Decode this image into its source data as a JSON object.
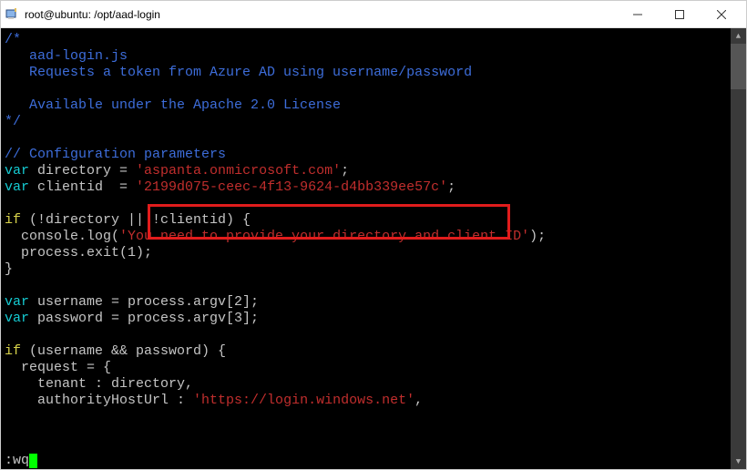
{
  "window": {
    "title": "root@ubuntu: /opt/aad-login"
  },
  "code": {
    "comment_open": "/*",
    "c1": "   aad-login.js",
    "c2": "   Requests a token from Azure AD using username/password",
    "c3": "   Available under the Apache 2.0 License",
    "comment_close": "*/",
    "comment_config": "// Configuration parameters",
    "var1_kw": "var",
    "var1_name": " directory = ",
    "var1_val": "'aspanta.onmicrosoft.com'",
    "var1_end": ";",
    "var2_kw": "var",
    "var2_name": " clientid  = ",
    "var2_val": "'2199d075-ceec-4f13-9624-d4bb339ee57c'",
    "var2_end": ";",
    "if1_kw": "if",
    "if1_cond": " (!directory || !clientid) {",
    "if1_b1a": "  console.log(",
    "if1_b1b": "'You need to provide your directory and client ID'",
    "if1_b1c": ");",
    "if1_b2": "  process.exit(1);",
    "if1_close": "}",
    "var3_kw": "var",
    "var3_rest": " username = process.argv[2];",
    "var4_kw": "var",
    "var4_rest": " password = process.argv[3];",
    "if2_kw": "if",
    "if2_cond": " (username && password) {",
    "if2_b1": "  request = {",
    "if2_b2": "    tenant : directory,",
    "if2_b3a": "    authorityHostUrl : ",
    "if2_b3b": "'https://login.windows.net'",
    "if2_b3c": ","
  },
  "status": {
    "cmd": ":wq"
  }
}
